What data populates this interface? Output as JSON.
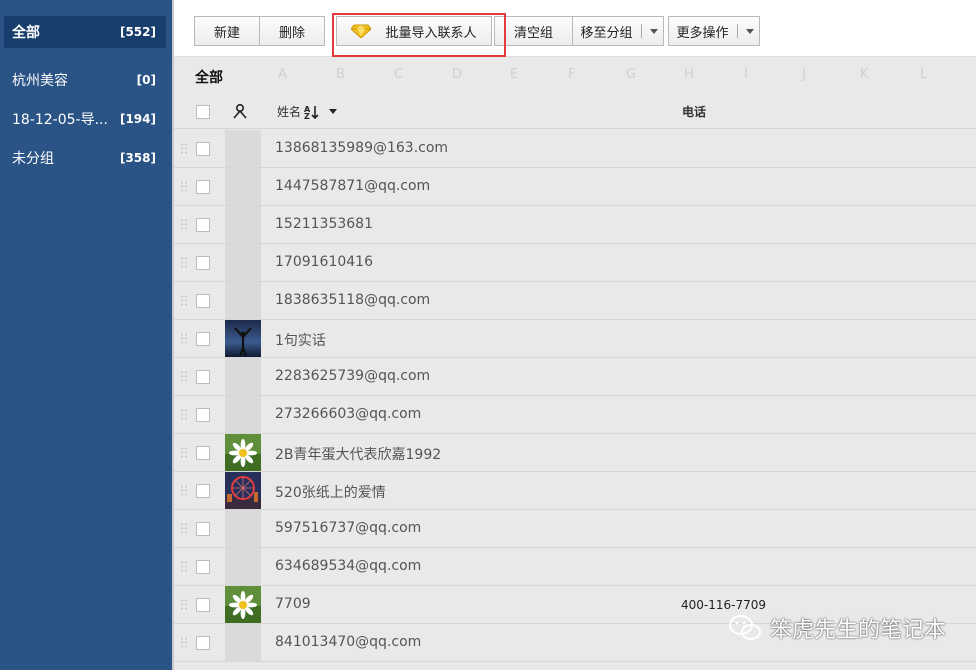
{
  "sidebar": {
    "items": [
      {
        "label": "全部",
        "count": "[552]"
      },
      {
        "label": "杭州美容",
        "count": "[0]"
      },
      {
        "label": "18-12-05-导...",
        "count": "[194]"
      },
      {
        "label": "未分组",
        "count": "[358]"
      }
    ]
  },
  "toolbar": {
    "new_label": "新建",
    "delete_label": "删除",
    "import_label": "批量导入联系人",
    "clear_label": "清空组",
    "move_label": "移至分组",
    "more_label": "更多操作"
  },
  "letters": {
    "all_label": "全部",
    "items": [
      "A",
      "B",
      "C",
      "D",
      "E",
      "F",
      "G",
      "H",
      "I",
      "J",
      "K",
      "L"
    ]
  },
  "table": {
    "name_header": "姓名",
    "phone_header": "电话",
    "rows": [
      {
        "name": "13868135989@163.com",
        "phone": "",
        "avatar": "none"
      },
      {
        "name": "1447587871@qq.com",
        "phone": "",
        "avatar": "none"
      },
      {
        "name": "15211353681",
        "phone": "",
        "avatar": "none"
      },
      {
        "name": "17091610416",
        "phone": "",
        "avatar": "none"
      },
      {
        "name": "1838635118@qq.com",
        "phone": "",
        "avatar": "none"
      },
      {
        "name": "1句实话",
        "phone": "",
        "avatar": "silhouette"
      },
      {
        "name": "2283625739@qq.com",
        "phone": "",
        "avatar": "none"
      },
      {
        "name": "273266603@qq.com",
        "phone": "",
        "avatar": "none"
      },
      {
        "name": "2B青年蛋大代表欣嘉1992",
        "phone": "",
        "avatar": "daisy"
      },
      {
        "name": "520张纸上的爱情",
        "phone": "",
        "avatar": "ferris-wheel"
      },
      {
        "name": "597516737@qq.com",
        "phone": "",
        "avatar": "none"
      },
      {
        "name": "634689534@qq.com",
        "phone": "",
        "avatar": "none"
      },
      {
        "name": "7709",
        "phone": "400-116-7709",
        "avatar": "daisy"
      },
      {
        "name": "841013470@qq.com",
        "phone": "",
        "avatar": "none"
      }
    ]
  },
  "watermark": {
    "text": "笨虎先生的笔记本"
  },
  "colors": {
    "sidebar": "#2a5386",
    "sidebar_active": "#173e6c",
    "highlight": "#e23b3b"
  }
}
